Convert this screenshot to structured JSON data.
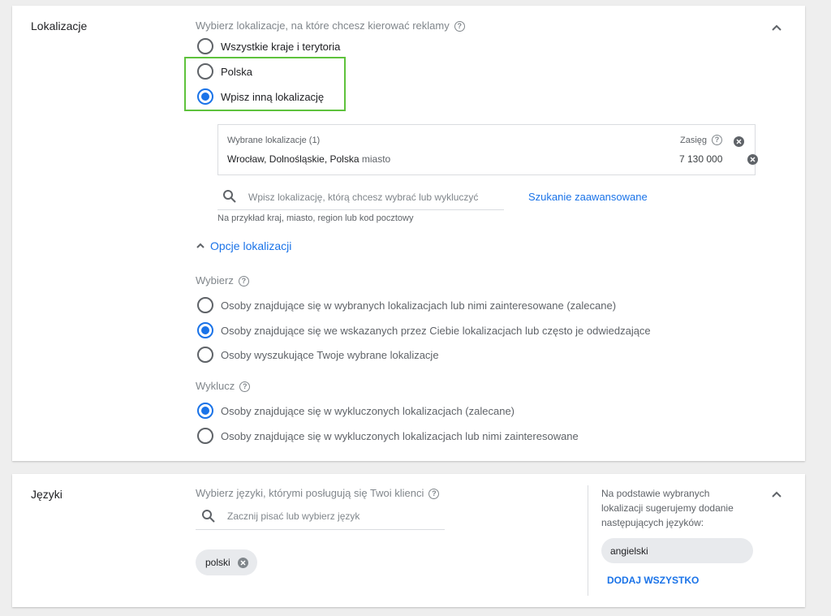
{
  "location": {
    "section_title": "Lokalizacje",
    "question": "Wybierz lokalizacje, na które chcesz kierować reklamy",
    "options": [
      {
        "label": "Wszystkie kraje i terytoria",
        "selected": false
      },
      {
        "label": "Polska",
        "selected": false
      },
      {
        "label": "Wpisz inną lokalizację",
        "selected": true
      }
    ],
    "selected_box": {
      "header": "Wybrane lokalizacje (1)",
      "reach_label": "Zasięg",
      "item_name": "Wrocław, Dolnośląskie, Polska",
      "item_type": "miasto",
      "item_reach": "7 130 000"
    },
    "search_placeholder": "Wpisz lokalizację, którą chcesz wybrać lub wykluczyć",
    "search_hint": "Na przykład kraj, miasto, region lub kod pocztowy",
    "advanced_search": "Szukanie zaawansowane",
    "options_toggle": "Opcje lokalizacji",
    "include_title": "Wybierz",
    "include_options": [
      {
        "label": "Osoby znajdujące się w wybranych lokalizacjach lub nimi zainteresowane (zalecane)",
        "selected": false
      },
      {
        "label": "Osoby znajdujące się we wskazanych przez Ciebie lokalizacjach lub często je odwiedzające",
        "selected": true
      },
      {
        "label": "Osoby wyszukujące Twoje wybrane lokalizacje",
        "selected": false
      }
    ],
    "exclude_title": "Wyklucz",
    "exclude_options": [
      {
        "label": "Osoby znajdujące się w wykluczonych lokalizacjach (zalecane)",
        "selected": true
      },
      {
        "label": "Osoby znajdujące się w wykluczonych lokalizacjach lub nimi zainteresowane",
        "selected": false
      }
    ]
  },
  "languages": {
    "section_title": "Języki",
    "question": "Wybierz języki, którymi posługują się Twoi klienci",
    "search_placeholder": "Zacznij pisać lub wybierz język",
    "selected_chip": "polski",
    "suggestion_text": "Na podstawie wybranych lokalizacji sugerujemy dodanie następujących języków:",
    "suggested_chip": "angielski",
    "add_all": "DODAJ WSZYSTKO"
  },
  "colors": {
    "accent": "#1a73e8",
    "highlight": "#5ec23c"
  }
}
